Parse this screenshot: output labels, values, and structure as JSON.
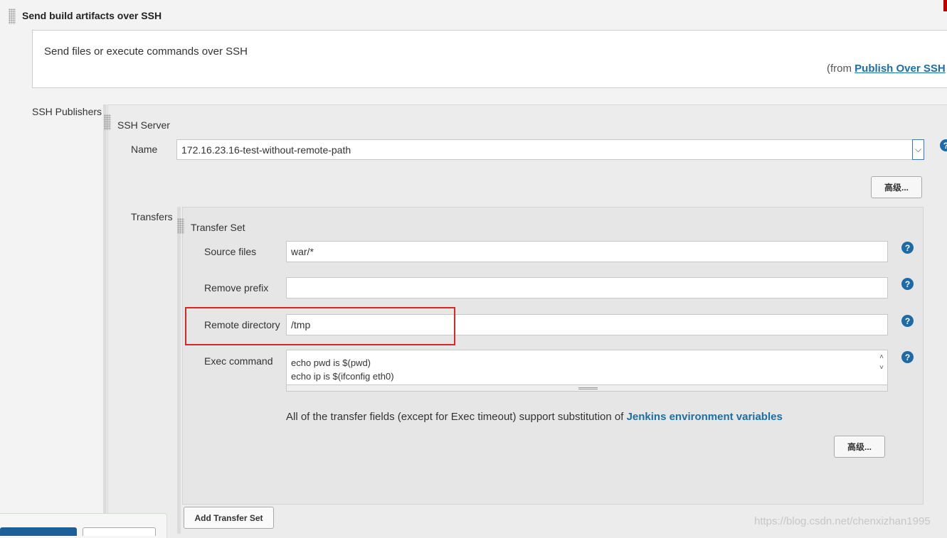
{
  "header": {
    "title": "Send build artifacts over SSH"
  },
  "description": {
    "text": "Send files or execute commands over SSH",
    "from_prefix": "(from ",
    "from_link": "Publish Over SSH"
  },
  "ssh_publishers": {
    "label": "SSH Publishers",
    "server_section": "SSH Server",
    "name_label": "Name",
    "name_value": "172.16.23.16-test-without-remote-path",
    "advanced_label": "高级..."
  },
  "transfers": {
    "label": "Transfers",
    "set_title": "Transfer Set",
    "source_files_label": "Source files",
    "source_files_value": "war/*",
    "remove_prefix_label": "Remove prefix",
    "remove_prefix_value": "",
    "remote_directory_label": "Remote directory",
    "remote_directory_value": "/tmp",
    "exec_command_label": "Exec command",
    "exec_command_lines": [
      "echo pwd is $(pwd)",
      "echo ip is $(ifconfig eth0)"
    ],
    "note_text": "All of the transfer fields (except for Exec timeout) support substitution of ",
    "note_link": "Jenkins environment variables",
    "advanced_label": "高级...",
    "add_button": "Add Transfer Set"
  },
  "help_icon_glyph": "?",
  "watermark": "https://blog.csdn.net/chenxizhan1995",
  "colors": {
    "link": "#1b6fa3",
    "help_icon": "#1d6aa8",
    "highlight": "#e02424",
    "select_focus": "#3b78c4"
  }
}
